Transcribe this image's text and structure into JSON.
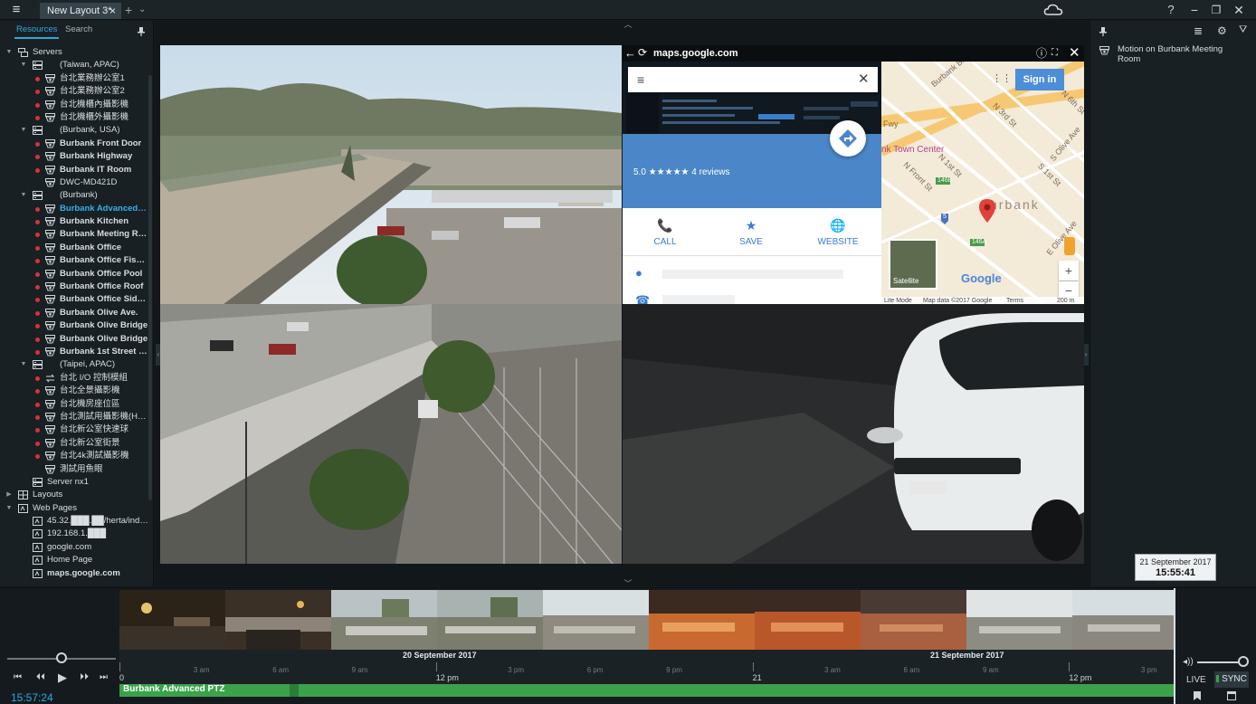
{
  "topbar": {
    "tab_label": "New Layout 3*",
    "tab_close": "×",
    "add_tab": "+",
    "more_tabs": "⌄",
    "help": "?",
    "minimize": "−",
    "restore": "❐",
    "close": "✕"
  },
  "left_panel": {
    "tab_resources": "Resources",
    "tab_search": "Search",
    "tree": [
      {
        "level": 0,
        "arrow": "▼",
        "icon": "servers-icon",
        "label": "Servers"
      },
      {
        "level": 1,
        "arrow": "▼",
        "icon": "server-icon",
        "label": "(Taiwan, APAC)"
      },
      {
        "level": 2,
        "dot": true,
        "icon": "camera-icon",
        "label": "台北業務辦公室1"
      },
      {
        "level": 2,
        "dot": true,
        "icon": "camera-icon",
        "label": "台北業務辦公室2"
      },
      {
        "level": 2,
        "dot": true,
        "icon": "camera-icon",
        "label": "台北機櫃內攝影機"
      },
      {
        "level": 2,
        "dot": true,
        "icon": "camera-icon",
        "label": "台北機櫃外攝影機"
      },
      {
        "level": 1,
        "arrow": "▼",
        "icon": "server-icon",
        "label": "(Burbank, USA)"
      },
      {
        "level": 2,
        "dot": true,
        "icon": "camera-icon",
        "label": "Burbank Front Door",
        "bold": true
      },
      {
        "level": 2,
        "dot": true,
        "icon": "camera-icon",
        "label": "Burbank Highway",
        "bold": true
      },
      {
        "level": 2,
        "dot": true,
        "icon": "camera-icon",
        "label": "Burbank IT Room",
        "bold": true
      },
      {
        "level": 2,
        "dot": false,
        "icon": "camera-icon",
        "label": "DWC-MD421D"
      },
      {
        "level": 1,
        "arrow": "▼",
        "icon": "server-icon",
        "label": "(Burbank)"
      },
      {
        "level": 2,
        "dot": true,
        "icon": "camera-icon",
        "label": "Burbank Advanced PTZ",
        "selected": true,
        "bold": true
      },
      {
        "level": 2,
        "dot": true,
        "icon": "camera-icon",
        "label": "Burbank Kitchen",
        "bold": true
      },
      {
        "level": 2,
        "dot": true,
        "icon": "camera-icon",
        "label": "Burbank Meeting Room",
        "bold": true
      },
      {
        "level": 2,
        "dot": true,
        "icon": "camera-icon",
        "label": "Burbank Office",
        "bold": true
      },
      {
        "level": 2,
        "dot": true,
        "icon": "camera-icon",
        "label": "Burbank Office Fisheye",
        "bold": true
      },
      {
        "level": 2,
        "dot": true,
        "icon": "camera-icon",
        "label": "Burbank Office Pool",
        "bold": true
      },
      {
        "level": 2,
        "dot": true,
        "icon": "camera-icon",
        "label": "Burbank Office Roof",
        "bold": true
      },
      {
        "level": 2,
        "dot": true,
        "icon": "camera-icon",
        "label": "Burbank Office Side ...",
        "bold": true
      },
      {
        "level": 2,
        "dot": true,
        "icon": "camera-icon",
        "label": "Burbank Olive Ave.",
        "bold": true
      },
      {
        "level": 2,
        "dot": true,
        "icon": "camera-icon",
        "label": "Burbank Olive Bridge",
        "bold": true
      },
      {
        "level": 2,
        "dot": true,
        "icon": "camera-icon",
        "label": "Burbank Olive Bridge",
        "bold": true
      },
      {
        "level": 2,
        "dot": true,
        "icon": "camera-icon",
        "label": "Burbank 1st Street Int...",
        "bold": true
      },
      {
        "level": 1,
        "arrow": "▼",
        "icon": "server-icon",
        "label": "(Taipei, APAC)"
      },
      {
        "level": 2,
        "dot": true,
        "icon": "io-module-icon",
        "label": "台北 I/O 控制模組"
      },
      {
        "level": 2,
        "dot": true,
        "icon": "camera-icon",
        "label": "台北全景攝影機"
      },
      {
        "level": 2,
        "dot": true,
        "icon": "camera-icon",
        "label": "台北機房座位區"
      },
      {
        "level": 2,
        "dot": true,
        "icon": "camera-icon",
        "label": "台北測試用攝影機(H2..."
      },
      {
        "level": 2,
        "dot": true,
        "icon": "camera-icon",
        "label": "台北新公室快速球"
      },
      {
        "level": 2,
        "dot": true,
        "icon": "camera-icon",
        "label": "台北新公室街景"
      },
      {
        "level": 2,
        "dot": true,
        "icon": "camera-icon",
        "label": "台北4k測試攝影機"
      },
      {
        "level": 2,
        "dot": false,
        "icon": "camera-icon",
        "label": "測試用魚眼"
      },
      {
        "level": 1,
        "icon": "server-icon",
        "label": "Server nx1"
      },
      {
        "level": 0,
        "arrow": "▶",
        "icon": "layouts-icon",
        "label": "Layouts"
      },
      {
        "level": 0,
        "arrow": "▼",
        "icon": "web-pages-icon",
        "label": "Web Pages"
      },
      {
        "level": 1,
        "icon": "web-page-icon",
        "label": "45.32.███.██/herta/inde..."
      },
      {
        "level": 1,
        "icon": "web-page-icon",
        "label": "192.168.1.███"
      },
      {
        "level": 1,
        "icon": "web-page-icon",
        "label": "google.com"
      },
      {
        "level": 1,
        "icon": "web-page-icon",
        "label": "Home Page"
      },
      {
        "level": 1,
        "icon": "web-page-icon",
        "label": "maps.google.com",
        "bold": true
      }
    ]
  },
  "web_item": {
    "back": "←",
    "reload": "⟳",
    "url": "maps.google.com",
    "info": "ⓘ",
    "fullscreen": "⛶",
    "close": "✕",
    "gmaps": {
      "menu": "≡",
      "clear": "✕",
      "rating": "5.0 ★★★★★   4 reviews",
      "actions": [
        {
          "icon": "📞",
          "label": "CALL"
        },
        {
          "icon": "★",
          "label": "SAVE"
        },
        {
          "icon": "🌐",
          "label": "WEBSITE"
        }
      ],
      "pin": "●",
      "phone": "☎"
    },
    "map": {
      "sign_in": "Sign in",
      "apps": "⋮⋮⋮",
      "town_center": "nk Town Center",
      "burbank": "urbank",
      "satellite": "Satellite",
      "zoom_in": "+",
      "zoom_out": "−",
      "google": "Google",
      "footer": [
        "Lite Mode",
        "Map data ©2017 Google",
        "Terms",
        "200 m"
      ],
      "streets": [
        "Burbank Blvd",
        "N 3rd St",
        "N 6th St",
        "Fwy",
        "N 1st St",
        "N Front St",
        "S 1st St",
        "S Olive Ave",
        "E Olive Ave",
        "146B",
        "146A",
        "5"
      ]
    }
  },
  "right_panel": {
    "notification": "Motion on Burbank Meeting Room",
    "list": "≣",
    "settings": "⚙",
    "filter": "⛛"
  },
  "timeline": {
    "date_left": "20 September 2017",
    "date_right": "21 September 2017",
    "ticks": [
      {
        "pos": 0.0,
        "label": "0",
        "major": true
      },
      {
        "pos": 0.077,
        "label": "3 am"
      },
      {
        "pos": 0.152,
        "label": "6 am"
      },
      {
        "pos": 0.227,
        "label": "9 am"
      },
      {
        "pos": 0.3,
        "label": "12 pm",
        "major": true
      },
      {
        "pos": 0.375,
        "label": "3 pm"
      },
      {
        "pos": 0.45,
        "label": "6 pm"
      },
      {
        "pos": 0.525,
        "label": "9 pm"
      },
      {
        "pos": 0.6,
        "label": "21",
        "major": true
      },
      {
        "pos": 0.675,
        "label": "3 am"
      },
      {
        "pos": 0.75,
        "label": "6 am"
      },
      {
        "pos": 0.825,
        "label": "9 am"
      },
      {
        "pos": 0.9,
        "label": "12 pm",
        "major": true
      },
      {
        "pos": 0.975,
        "label": "3 pm"
      }
    ],
    "track_label": "Burbank Advanced PTZ",
    "cursor_date": "21 September 2017",
    "cursor_time": "15:55:41",
    "current_time": "15:57:24",
    "live": "LIVE",
    "sync": "SYNC",
    "start": "⏮",
    "prev": "⏴⏴",
    "play": "▶",
    "next": "⏵⏵",
    "end": "⏭",
    "volume": "◂))"
  },
  "colors": {
    "accent": "#2fa8e0",
    "status_red": "#d8323a",
    "track_green": "#3aa24a"
  }
}
